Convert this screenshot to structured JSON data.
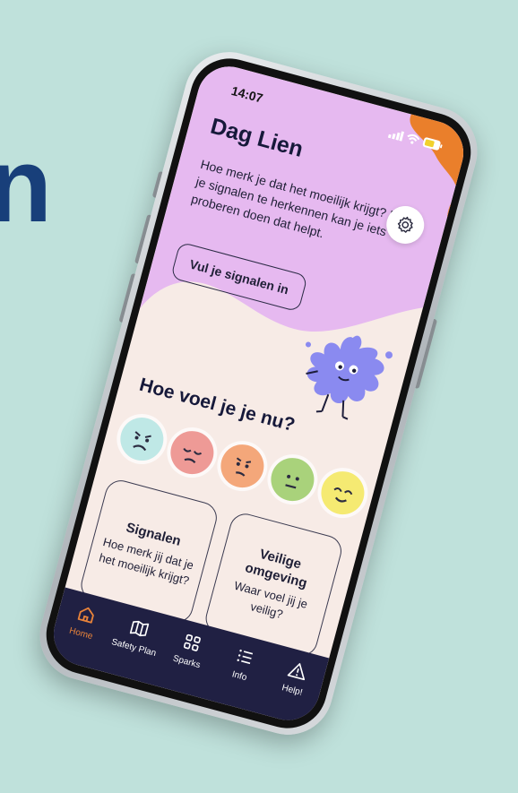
{
  "background_text": "n",
  "status": {
    "time": "14:07"
  },
  "header": {
    "greeting": "Dag Lien",
    "intro": "Hoe merk je dat het moeilijk krijgt? Door je signalen te herkennen kan je iets proberen doen dat helpt.",
    "fill_signals_label": "Vul je signalen in"
  },
  "mood": {
    "title": "Hoe voel je je nu?",
    "options": [
      {
        "icon": "frowning-face-icon",
        "color": "#bfe8e6"
      },
      {
        "icon": "sad-face-icon",
        "color": "#ee9a96"
      },
      {
        "icon": "worried-face-icon",
        "color": "#f4a77a"
      },
      {
        "icon": "neutral-face-icon",
        "color": "#a9d27b"
      },
      {
        "icon": "smiling-face-icon",
        "color": "#f5ea72"
      }
    ]
  },
  "cards": [
    {
      "title": "Signalen",
      "text": "Hoe merk jij dat je het moeilijk krijgt?"
    },
    {
      "title": "Veilige omgeving",
      "text": "Waar voel jij je veilig?"
    }
  ],
  "nav": [
    {
      "label": "Home",
      "icon": "home-icon",
      "active": true
    },
    {
      "label": "Safety Plan",
      "icon": "map-icon",
      "active": false
    },
    {
      "label": "Sparks",
      "icon": "grid-icon",
      "active": false
    },
    {
      "label": "Info",
      "icon": "list-icon",
      "active": false
    },
    {
      "label": "Help!",
      "icon": "warning-icon",
      "active": false
    }
  ],
  "colors": {
    "page_bg": "#bfe1db",
    "header_purple": "#e6b9f0",
    "accent_orange": "#ea7f2b",
    "screen_bg": "#f7ebe6",
    "navbar": "#202043",
    "mascot": "#8a8af0"
  }
}
